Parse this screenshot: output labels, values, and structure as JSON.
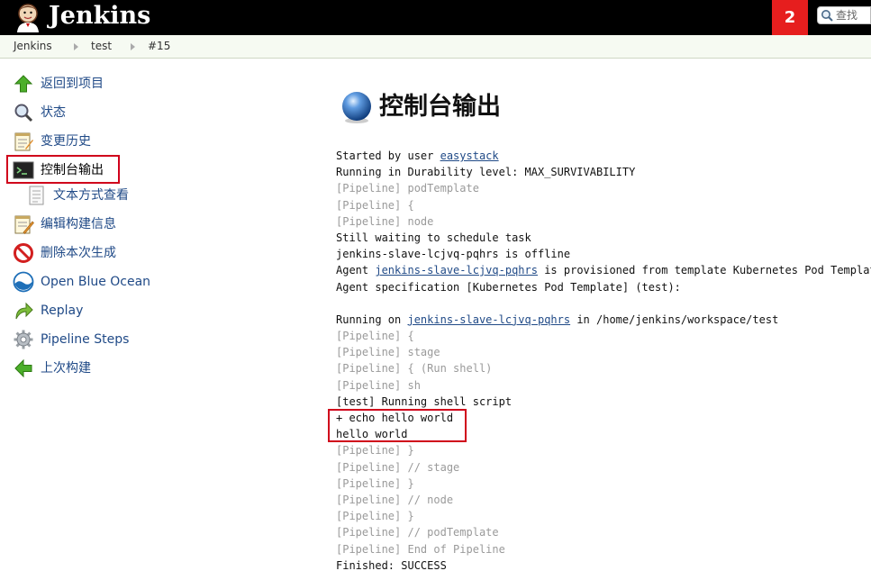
{
  "header": {
    "brand": "Jenkins",
    "notification_count": "2",
    "search_placeholder": "查找"
  },
  "breadcrumb": [
    "Jenkins",
    "test",
    "#15"
  ],
  "sidebar": {
    "items": [
      {
        "label": "返回到项目"
      },
      {
        "label": "状态"
      },
      {
        "label": "变更历史"
      },
      {
        "label": "控制台输出"
      },
      {
        "label": "文本方式查看"
      },
      {
        "label": "编辑构建信息"
      },
      {
        "label": "删除本次生成"
      },
      {
        "label": "Open Blue Ocean"
      },
      {
        "label": "Replay"
      },
      {
        "label": "Pipeline Steps"
      },
      {
        "label": "上次构建"
      }
    ]
  },
  "main": {
    "title": "控制台输出",
    "console": [
      {
        "text": "Started by user ",
        "link": "easystack",
        "after": ""
      },
      {
        "text": "Running in Durability level: MAX_SURVIVABILITY"
      },
      {
        "text": "[Pipeline] podTemplate",
        "dim": true
      },
      {
        "text": "[Pipeline] {",
        "dim": true
      },
      {
        "text": "[Pipeline] node",
        "dim": true
      },
      {
        "text": "Still waiting to schedule task"
      },
      {
        "text": "jenkins-slave-lcjvq-pqhrs is offline"
      },
      {
        "text": "Agent ",
        "link": "jenkins-slave-lcjvq-pqhrs",
        "after": " is provisioned from template Kubernetes Pod Template"
      },
      {
        "text": "Agent specification [Kubernetes Pod Template] (test):"
      },
      {
        "text": ""
      },
      {
        "text": "Running on ",
        "link": "jenkins-slave-lcjvq-pqhrs",
        "after": " in /home/jenkins/workspace/test"
      },
      {
        "text": "[Pipeline] {",
        "dim": true
      },
      {
        "text": "[Pipeline] stage",
        "dim": true
      },
      {
        "text": "[Pipeline] { (Run shell)",
        "dim": true
      },
      {
        "text": "[Pipeline] sh",
        "dim": true
      },
      {
        "text": "[test] Running shell script"
      },
      {
        "text": "+ echo hello world"
      },
      {
        "text": "hello world"
      },
      {
        "text": "[Pipeline] }",
        "dim": true
      },
      {
        "text": "[Pipeline] // stage",
        "dim": true
      },
      {
        "text": "[Pipeline] }",
        "dim": true
      },
      {
        "text": "[Pipeline] // node",
        "dim": true
      },
      {
        "text": "[Pipeline] }",
        "dim": true
      },
      {
        "text": "[Pipeline] // podTemplate",
        "dim": true
      },
      {
        "text": "[Pipeline] End of Pipeline",
        "dim": true
      },
      {
        "text": "Finished: SUCCESS"
      }
    ]
  }
}
